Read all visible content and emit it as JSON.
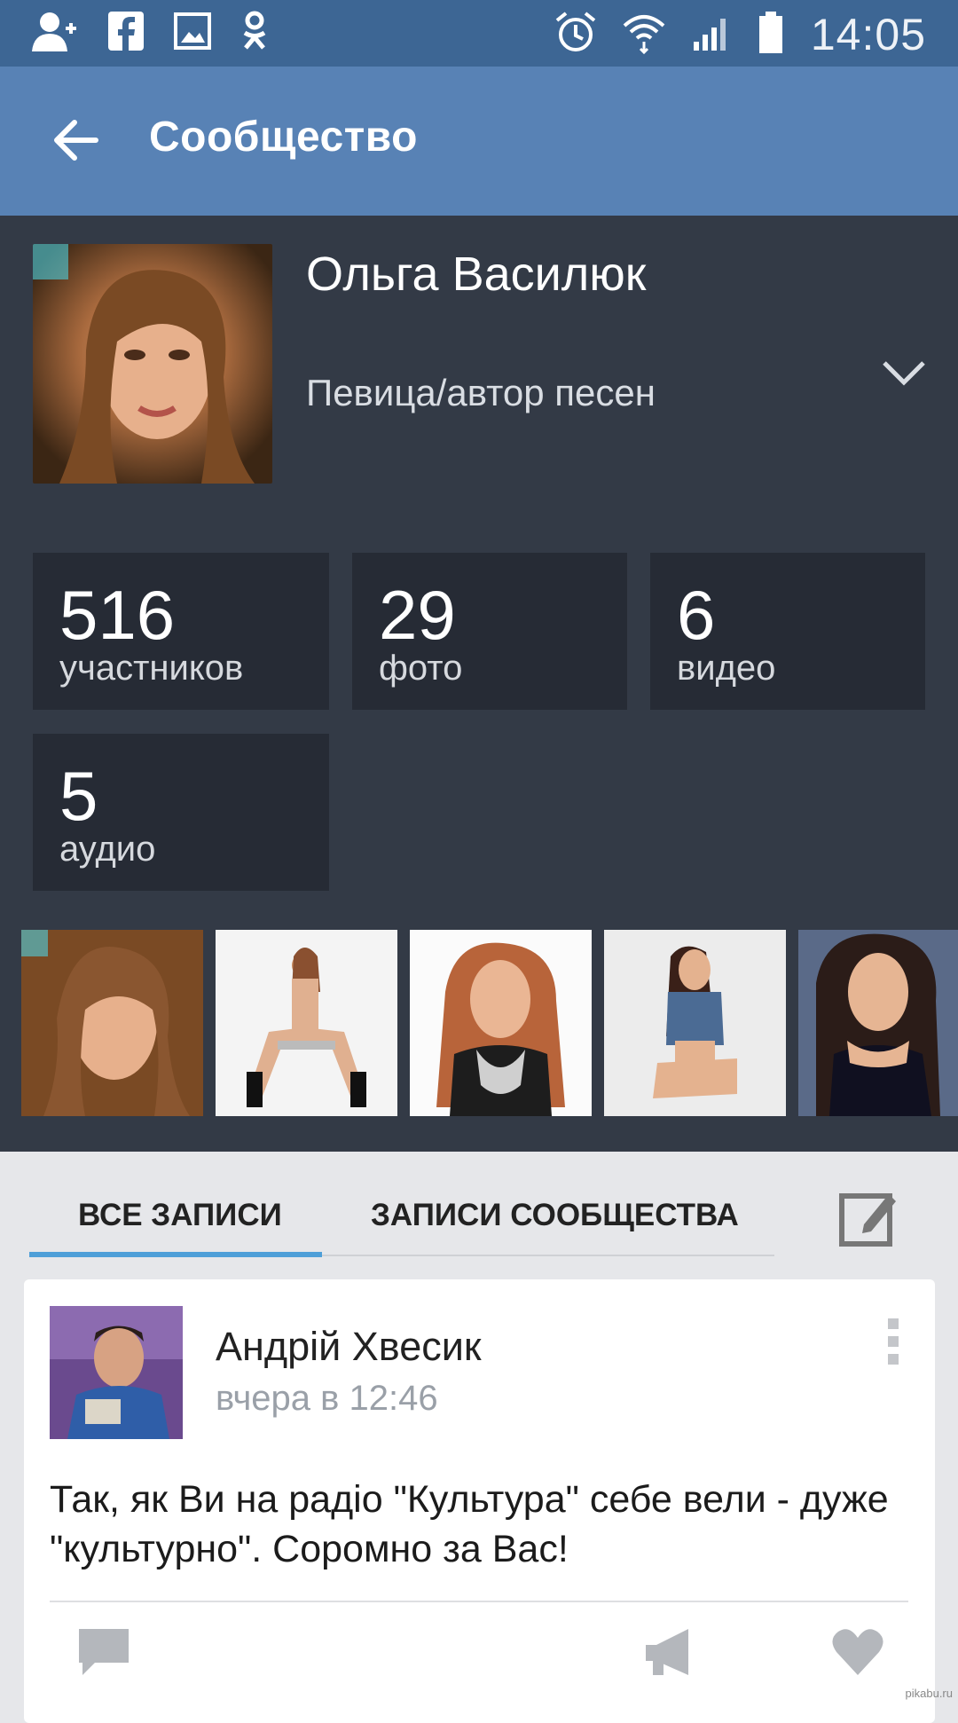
{
  "status_bar": {
    "time": "14:05",
    "left_icons": [
      "add-user-icon",
      "facebook-icon",
      "gallery-icon",
      "odnoklassniki-icon"
    ],
    "right_icons": [
      "alarm-icon",
      "wifi-icon",
      "signal-icon",
      "battery-icon"
    ]
  },
  "app_bar": {
    "title": "Сообщество"
  },
  "profile": {
    "name": "Ольга Василюк",
    "status": "Певица/автор песен"
  },
  "stats": [
    {
      "value": "516",
      "label": "участников"
    },
    {
      "value": "29",
      "label": "фото"
    },
    {
      "value": "6",
      "label": "видео"
    },
    {
      "value": "5",
      "label": "аудио"
    }
  ],
  "tabs": {
    "all": "ВСЕ ЗАПИСИ",
    "community": "ЗАПИСИ СООБЩЕСТВА",
    "active": "all"
  },
  "post": {
    "author": "Андрій Хвесик",
    "time": "вчера в 12:46",
    "text": "Так, як Ви на радіо \"Культура\" себе вели - дуже \"культурно\". Соромно за Вас!"
  },
  "watermark": "pikabu.ru",
  "colors": {
    "status_bar": "#3d6694",
    "app_bar": "#5882b5",
    "profile_bg": "#333a46",
    "stat_bg": "#262b35",
    "tab_accent": "#4e9fd8"
  }
}
